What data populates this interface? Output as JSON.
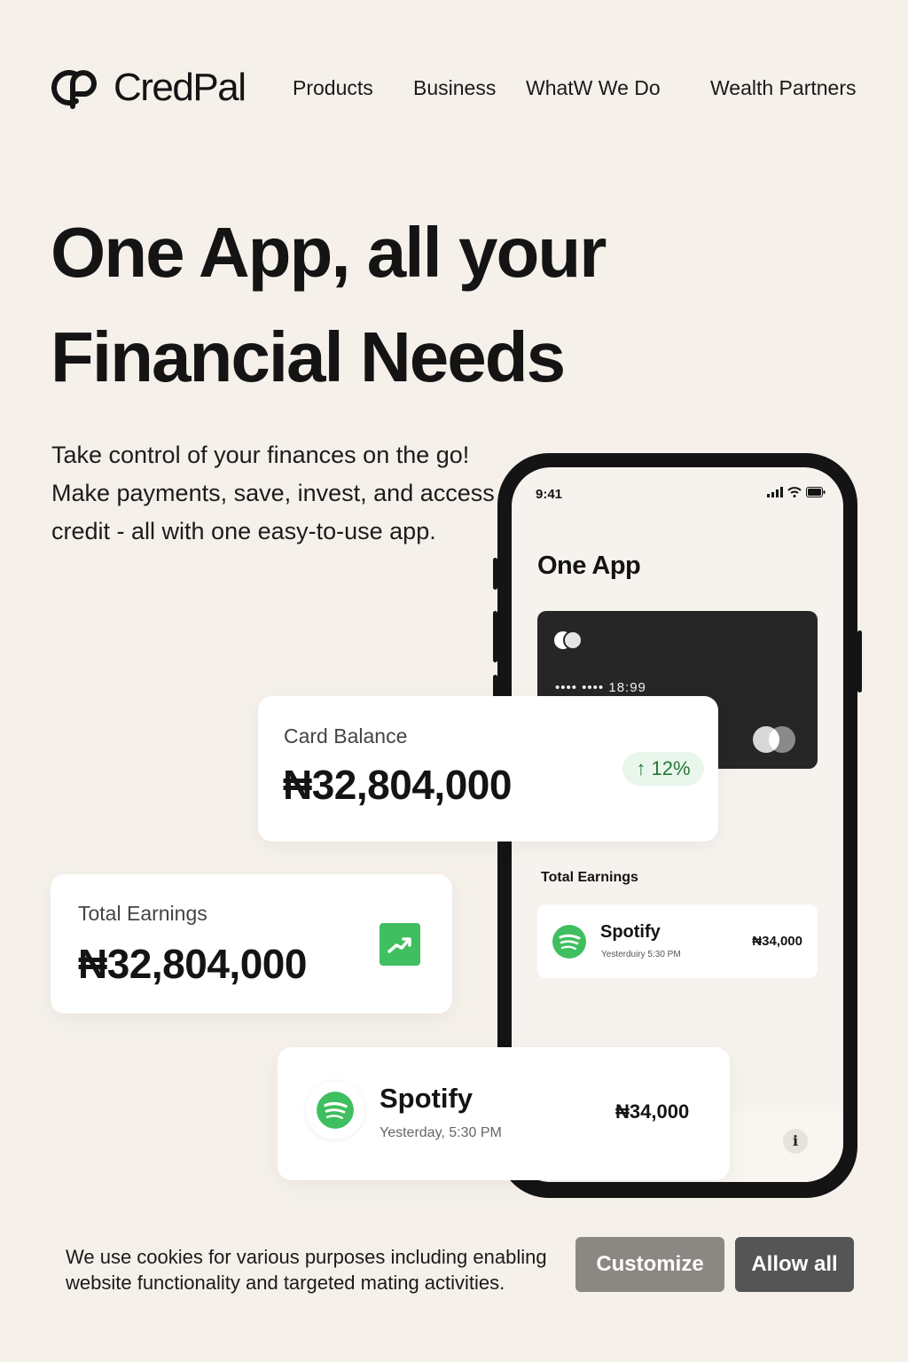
{
  "header": {
    "brand": "CredPal",
    "nav": [
      "Products",
      "Business",
      "WhatW We Do",
      "Wealth Partners"
    ]
  },
  "hero": {
    "title_line1": "One App, all your",
    "title_line2": "Financial Needs",
    "subtitle": "Take control of your finances on the go! Make payments, save, invest, and access credit - all with one easy-to-use app."
  },
  "phone": {
    "time": "9:41",
    "title": "One App",
    "card_number": "•••• •••• 18:99",
    "earnings_label": "Total Earnings",
    "transaction": {
      "name": "Spotify",
      "time": "Yesterduiry 5:30 PM",
      "amount": "₦34,000"
    },
    "info_icon": "i"
  },
  "card_balance": {
    "label": "Card Balance",
    "value": "₦32,804,000",
    "change": "↑ 12%"
  },
  "total_earnings": {
    "label": "Total Earnings",
    "value": "₦32,804,000"
  },
  "transaction": {
    "name": "Spotify",
    "time": "Yesterday, 5:30 PM",
    "amount": "₦34,000"
  },
  "cookie": {
    "text": "We use cookies for various purposes including enabling website functionality and targeted mating activities.",
    "customize_label": "Customize",
    "allow_label": "Allow all"
  },
  "colors": {
    "background": "#f5f0ea",
    "spotify_green": "#3fbf5f",
    "growth_green": "#237a38",
    "customize_button": "#8b8782",
    "allow_button": "#555555"
  },
  "icons": [
    "credpal-logo-icon",
    "signal-icon",
    "wifi-icon",
    "battery-icon",
    "card-chip-icon",
    "card-brand-icon",
    "spotify-icon",
    "trend-up-icon",
    "info-icon"
  ]
}
